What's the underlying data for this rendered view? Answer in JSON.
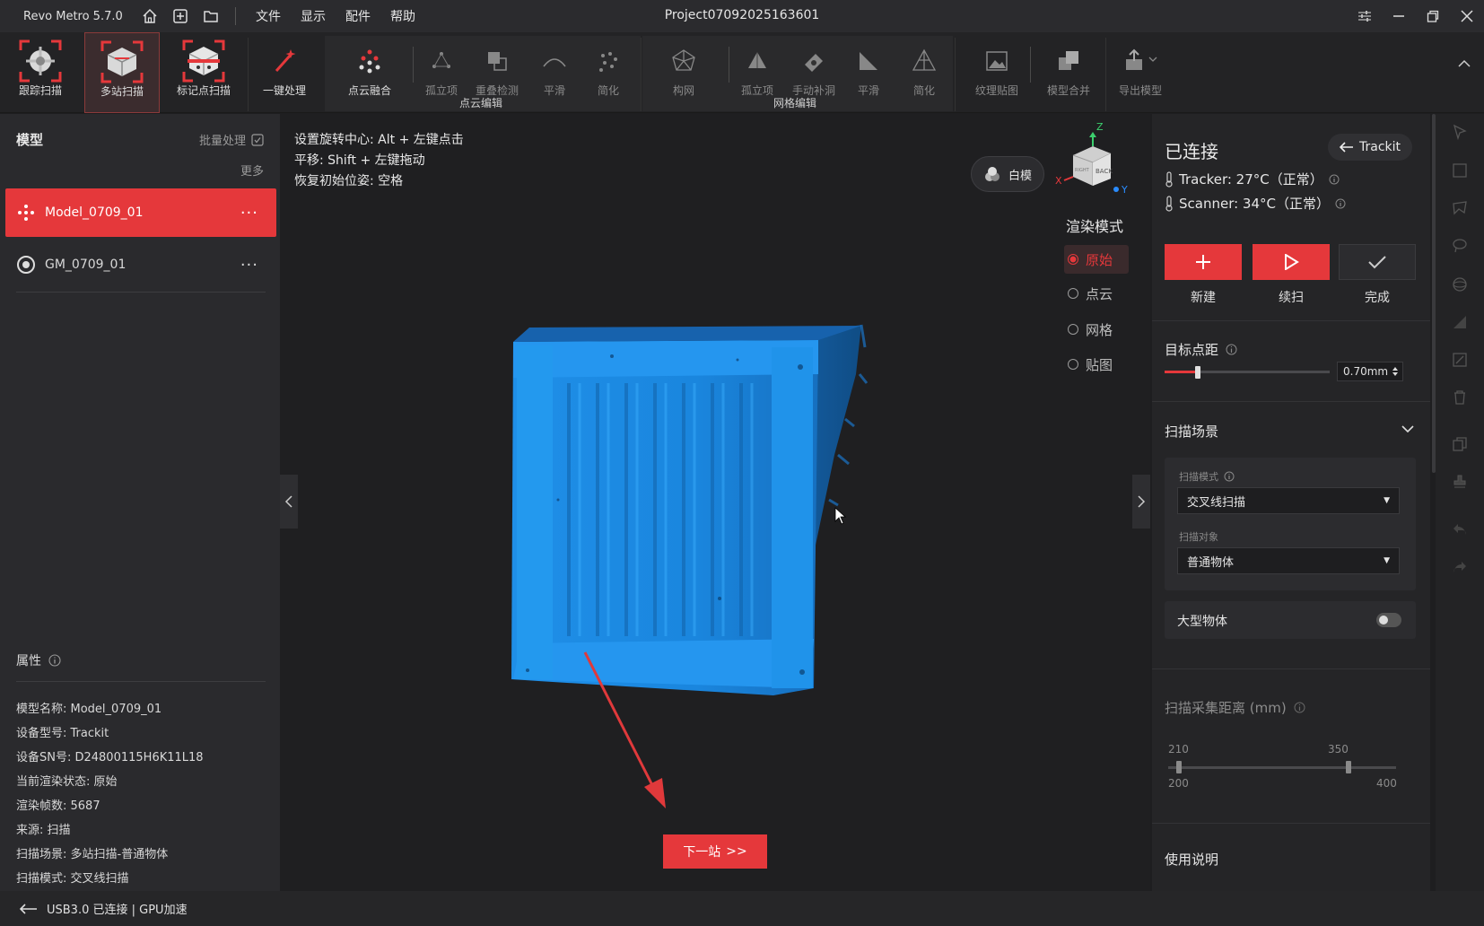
{
  "app": {
    "name": "Revo Metro 5.7.0",
    "menus": [
      "文件",
      "显示",
      "配件",
      "帮助"
    ],
    "project_title": "Project07092025163601"
  },
  "toolbar": {
    "tools": [
      {
        "label": "跟踪扫描",
        "enabled": true
      },
      {
        "label": "多站扫描",
        "enabled": true,
        "active": true
      },
      {
        "label": "标记点扫描",
        "enabled": true
      },
      {
        "label": "一键处理",
        "enabled": true
      },
      {
        "label": "点云融合",
        "enabled": true
      },
      {
        "label": "孤立项",
        "enabled": false
      },
      {
        "label": "重叠检测",
        "enabled": false
      },
      {
        "label": "平滑",
        "enabled": false
      },
      {
        "label": "简化",
        "enabled": false
      },
      {
        "label": "构网",
        "enabled": false
      },
      {
        "label": "孤立项",
        "enabled": false
      },
      {
        "label": "手动补洞",
        "enabled": false
      },
      {
        "label": "平滑",
        "enabled": false
      },
      {
        "label": "简化",
        "enabled": false
      },
      {
        "label": "纹理贴图",
        "enabled": false
      },
      {
        "label": "模型合并",
        "enabled": false
      },
      {
        "label": "导出模型",
        "enabled": false
      }
    ],
    "groups": {
      "point_cloud_edit": "点云编辑",
      "mesh_edit": "网格编辑"
    }
  },
  "left_panel": {
    "title": "模型",
    "batch_label": "批量处理",
    "more_label": "更多",
    "models": [
      {
        "name": "Model_0709_01",
        "selected": true
      },
      {
        "name": "GM_0709_01",
        "selected": false
      }
    ],
    "properties_title": "属性",
    "properties": [
      "模型名称: Model_0709_01",
      "设备型号: Trackit",
      "设备SN号: D24800115H6K11L18",
      "当前渲染状态: 原始",
      "渲染帧数: 5687",
      "来源: 扫描",
      "扫描场景: 多站扫描-普通物体",
      "扫描模式: 交叉线扫描"
    ]
  },
  "viewport": {
    "hints": [
      "设置旋转中心: Alt + 左键点击",
      "平移: Shift + 左键拖动",
      "恢复初始位姿: 空格"
    ],
    "white_model_label": "白模",
    "render_mode_title": "渲染模式",
    "render_modes": [
      {
        "label": "原始",
        "selected": true
      },
      {
        "label": "点云",
        "selected": false
      },
      {
        "label": "网格",
        "selected": false
      },
      {
        "label": "贴图",
        "selected": false
      }
    ],
    "axis_labels": {
      "z": "Z",
      "x": "X",
      "y": "Y",
      "cube_face": "BACK",
      "cube_side": "RIGHT"
    },
    "next_station_label": "下一站",
    "next_station_glyph": ">>",
    "model_color": "#1f8fe8",
    "arrow_color": "#e0393b"
  },
  "right_panel": {
    "status": "已连接",
    "device_button": "Trackit",
    "tracker_temp": "Tracker: 27°C（正常）",
    "scanner_temp": "Scanner: 34°C（正常）",
    "actions": [
      {
        "label": "新建",
        "icon": "plus-icon"
      },
      {
        "label": "续扫",
        "icon": "play-icon"
      },
      {
        "label": "完成",
        "icon": "check-icon"
      }
    ],
    "target_spacing_title": "目标点距",
    "target_spacing_value": "0.70mm",
    "target_spacing_fraction": 0.2,
    "scan_scene_title": "扫描场景",
    "scan_mode_label": "扫描模式",
    "scan_mode_value": "交叉线扫描",
    "scan_object_label": "扫描对象",
    "scan_object_value": "普通物体",
    "large_object_label": "大型物体",
    "large_object_on": false,
    "distance_title": "扫描采集距离 (mm)",
    "distance_low": "210",
    "distance_high": "350",
    "distance_min": "200",
    "distance_max": "400",
    "instructions": "使用说明"
  },
  "status_bar": {
    "text": "USB3.0 已连接 | GPU加速"
  },
  "colors": {
    "accent": "#e5383b",
    "background": "#1e1e20",
    "panel": "#2a2a2d"
  }
}
